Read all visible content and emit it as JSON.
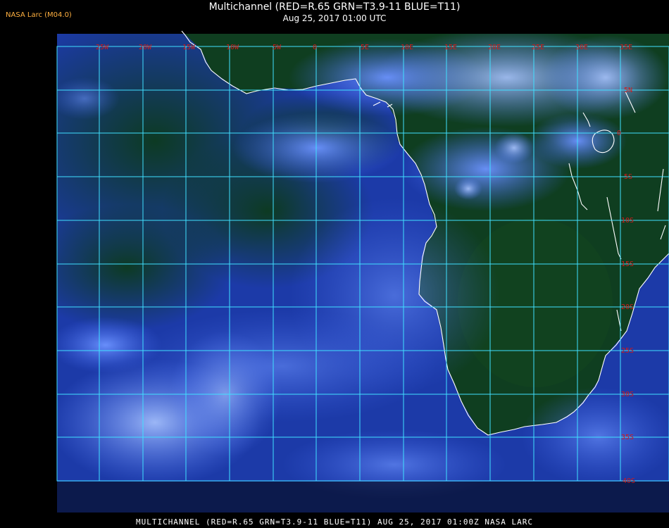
{
  "header": {
    "credit": "NASA Larc (M04.0)",
    "title": "Multichannel (RED=R.65 GRN=T3.9-11 BLUE=T11)",
    "datetime": "Aug 25, 2017 01:00 UTC"
  },
  "map": {
    "lon_labels": [
      "25W",
      "20W",
      "15W",
      "10W",
      "5W",
      "0",
      "5E",
      "10E",
      "15E",
      "20E",
      "25E",
      "30E",
      "35E"
    ],
    "lat_labels": [
      "5N",
      "0",
      "5S",
      "10S",
      "15S",
      "20S",
      "25S",
      "30S",
      "35S",
      "40S"
    ],
    "colors": {
      "grid": "#40e0ff",
      "coast": "#ffffff",
      "land": "#0f3e20",
      "ocean": "#1c3aa8",
      "cloud": "#4d7dff",
      "label": "#d21a1a"
    }
  },
  "footer": {
    "caption": "MULTICHANNEL (RED=R.65 GRN=T3.9-11 BLUE=T11) AUG 25, 2017 01:00Z   NASA LARC"
  }
}
